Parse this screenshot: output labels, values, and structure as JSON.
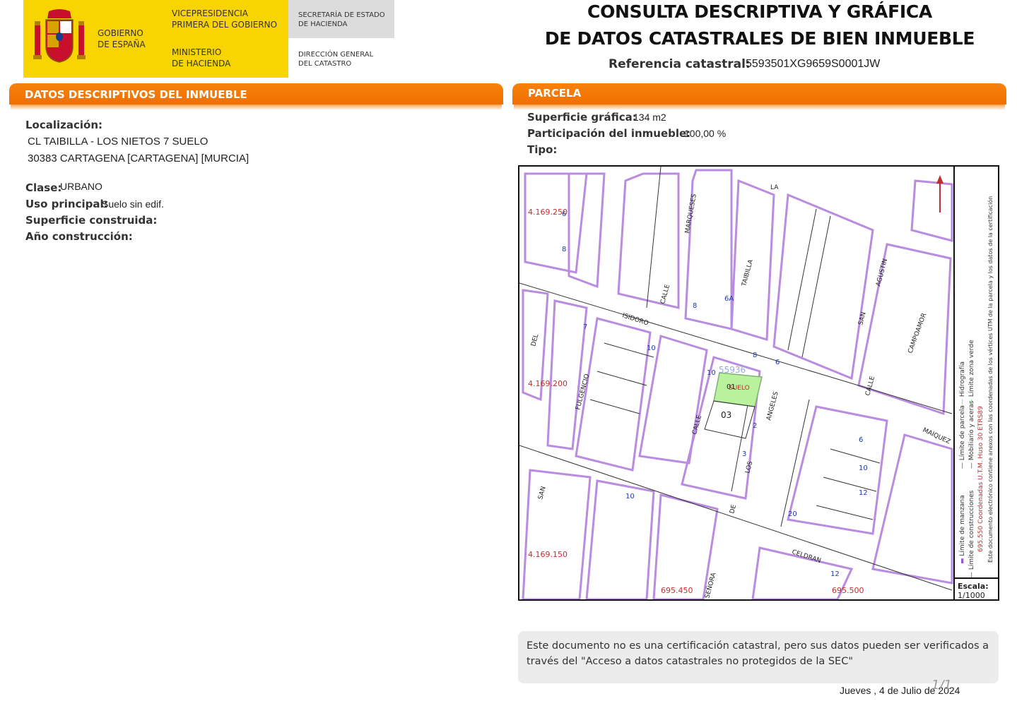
{
  "header": {
    "gov_line1": "GOBIERNO",
    "gov_line2": "DE ESPAÑA",
    "vice_line1": "VICEPRESIDENCIA",
    "vice_line2": "PRIMERA DEL GOBIERNO",
    "min_line1": "MINISTERIO",
    "min_line2": "DE HACIENDA",
    "sec_line1": "SECRETARÍA DE ESTADO",
    "sec_line2": "DE HACIENDA",
    "dir_line1": "DIRECCIÓN GENERAL",
    "dir_line2": "DEL CATASTRO"
  },
  "title": {
    "line1": "CONSULTA DESCRIPTIVA Y GRÁFICA",
    "line2": "DE DATOS CATASTRALES DE BIEN INMUEBLE",
    "ref_label": "Referencia catastral:",
    "ref_value": "5593501XG9659S0001JW"
  },
  "descriptivos": {
    "section_title": "DATOS DESCRIPTIVOS DEL INMUEBLE",
    "localizacion_label": "Localización:",
    "localizacion_line1": "CL TAIBILLA - LOS NIETOS 7 SUELO",
    "localizacion_line2": "30383 CARTAGENA [CARTAGENA] [MURCIA]",
    "clase_label": "Clase:",
    "clase_value": "URBANO",
    "uso_label": "Uso principal:",
    "uso_value": "Suelo sin edif.",
    "superficie_label": "Superficie construida:",
    "anio_label": "Año construcción:"
  },
  "parcela": {
    "section_title": "PARCELA",
    "sup_label": "Superficie gráfica:",
    "sup_value": "134 m2",
    "part_label": "Participación del inmueble:",
    "part_value": "100,00 %",
    "tipo_label": "Tipo:"
  },
  "map": {
    "coord_y1": "4.169.250",
    "coord_y2": "4.169.200",
    "coord_y3": "4.169.150",
    "coord_x1": "695.450",
    "coord_x2": "695.500",
    "parcel_ref": "55936",
    "parcel_label": "SUELO",
    "parcel_num": "01",
    "num_03": "03",
    "streets": [
      "CALLE",
      "ISIDORO",
      "TAIBILLA",
      "MARQUESES",
      "AGUSTIN",
      "SAN",
      "CAMPOAMOR",
      "FULGENCIO",
      "CALLE",
      "LOS",
      "ANGELES",
      "DE",
      "MAIQUEZ",
      "CELDRAN",
      "SEÑORA",
      "SAN",
      "DEL",
      "LA"
    ],
    "legend1": "Límite de manzana",
    "legend2": "Límite de parcela",
    "legend3": "Hidrografía",
    "legend4": "Límite de construcciones",
    "legend5": "Mobiliario y aceras",
    "legend6": "Límite zona verde",
    "legend7": "Coordenadas U.T.M. Huso 30 ETRS89",
    "legend8": "Este documento electrónico contiene anexos con las coordenadas de los vértices UTM de la parcela y los datos de la certificación",
    "legend_coord": "695.550",
    "scale_label": "Escala:",
    "scale_value": "1/1000"
  },
  "footer": {
    "notice": "Este documento no es una certificación catastral, pero sus datos pueden ser verificados a través del \"Acceso a datos catastrales no protegidos de la SEC\"",
    "date": "Jueves , 4 de Julio de 2024",
    "page": "1/1"
  }
}
